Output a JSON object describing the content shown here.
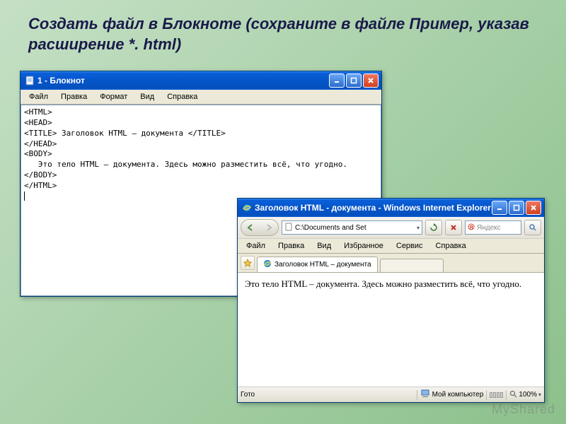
{
  "slide": {
    "title": "Создать файл в Блокноте (сохраните в файле Пример,  указав расширение   *. html)",
    "watermark": "MyShared"
  },
  "notepad": {
    "title": "1 - Блокнот",
    "menu": [
      "Файл",
      "Правка",
      "Формат",
      "Вид",
      "Справка"
    ],
    "lines": [
      "<HTML>",
      "<HEAD>",
      "<TITLE> Заголовок HTML – документа </TITLE>",
      "</HEAD>",
      "<BODY>",
      "   Это тело HTML – документа. Здесь можно разместить всё, что угодно.",
      "</BODY>",
      "</HTML>"
    ]
  },
  "ie": {
    "title": "Заголовок HTML - документа - Windows Internet Explorer",
    "address": "C:\\Documents and Set",
    "search_placeholder": "Яндекс",
    "menu": [
      "Файл",
      "Правка",
      "Вид",
      "Избранное",
      "Сервис",
      "Справка"
    ],
    "tab_label": "Заголовок HTML – документа",
    "body_text": "Это тело HTML – документа. Здесь можно разместить всё, что угодно.",
    "status_left": "Гото",
    "status_zone": "Мой компьютер",
    "zoom": "100%"
  }
}
